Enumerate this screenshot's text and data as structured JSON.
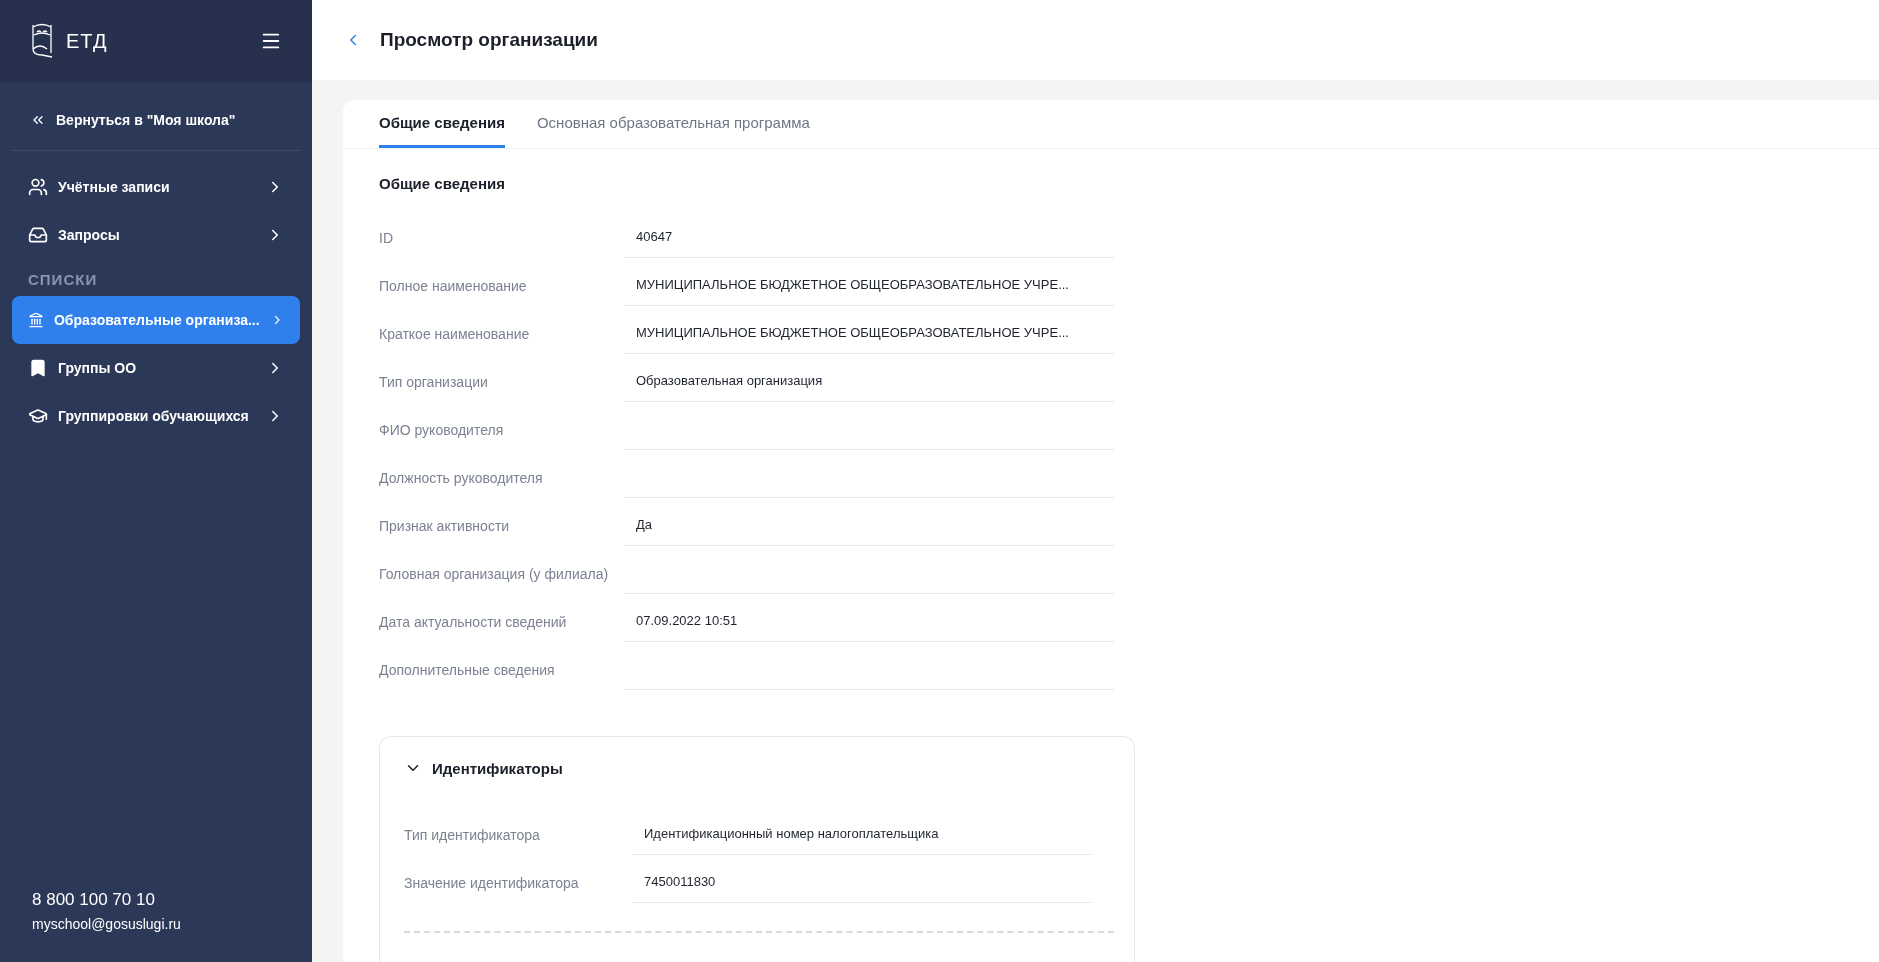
{
  "sidebar": {
    "logo_text": "ЕТД",
    "back_link": "Вернуться в \"Моя школа\"",
    "items": [
      {
        "kind": "item",
        "label": "Учётные записи",
        "selected": false
      },
      {
        "kind": "item",
        "label": "Запросы",
        "selected": false
      },
      {
        "kind": "section",
        "label": "СПИСКИ"
      },
      {
        "kind": "item",
        "label": "Образовательные организа...",
        "selected": true
      },
      {
        "kind": "item",
        "label": "Группы ОО",
        "selected": false
      },
      {
        "kind": "item",
        "label": "Группировки обучающихся",
        "selected": false
      }
    ],
    "phone": "8 800 100 70 10",
    "email": "myschool@gosuslugi.ru"
  },
  "header": {
    "title": "Просмотр организации"
  },
  "tabs": [
    {
      "label": "Общие сведения",
      "selected": true
    },
    {
      "label": "Основная образовательная программа",
      "selected": false
    }
  ],
  "section_title": "Общие сведения",
  "fields": [
    {
      "label": "ID",
      "value": "40647"
    },
    {
      "label": "Полное наименование",
      "value": "МУНИЦИПАЛЬНОЕ БЮДЖЕТНОЕ ОБЩЕОБРАЗОВАТЕЛЬНОЕ УЧРЕ..."
    },
    {
      "label": "Краткое наименование",
      "value": "МУНИЦИПАЛЬНОЕ БЮДЖЕТНОЕ ОБЩЕОБРАЗОВАТЕЛЬНОЕ УЧРЕ..."
    },
    {
      "label": "Тип организации",
      "value": "Образовательная организация"
    },
    {
      "label": "ФИО руководителя"
    },
    {
      "label": "Должность руководителя"
    },
    {
      "label": "Признак активности",
      "value": "Да"
    },
    {
      "label": "Головная организация (у филиала)"
    },
    {
      "label": "Дата актуальности сведений",
      "value": "07.09.2022 10:51"
    },
    {
      "label": "Дополнительные сведения"
    }
  ],
  "identifiers": {
    "title": "Идентификаторы",
    "expanded": true,
    "fields": [
      {
        "label": "Тип идентификатора",
        "value": "Идентификационный номер налогоплательщика"
      },
      {
        "label": "Значение идентификатора",
        "value": "7450011830"
      }
    ]
  }
}
